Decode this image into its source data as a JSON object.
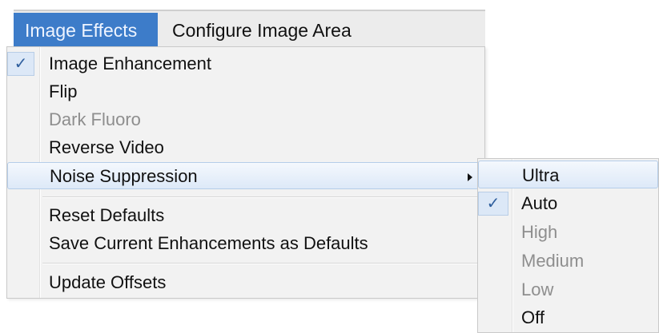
{
  "menubar": {
    "items": [
      {
        "label": "Image Effects"
      },
      {
        "label": "Configure Image Area"
      }
    ]
  },
  "menu": {
    "items": [
      {
        "label": "Image Enhancement",
        "checked": true
      },
      {
        "label": "Flip"
      },
      {
        "label": "Dark Fluoro",
        "disabled": true
      },
      {
        "label": "Reverse Video"
      },
      {
        "label": "Noise Suppression",
        "has_submenu": true,
        "highlighted": true
      },
      {
        "label": "Reset Defaults"
      },
      {
        "label": "Save Current Enhancements as Defaults"
      },
      {
        "label": "Update Offsets"
      }
    ],
    "check_glyph": "✓"
  },
  "submenu": {
    "items": [
      {
        "label": "Ultra",
        "highlighted": true
      },
      {
        "label": "Auto",
        "checked": true
      },
      {
        "label": "High",
        "disabled": true
      },
      {
        "label": "Medium",
        "disabled": true
      },
      {
        "label": "Low",
        "disabled": true
      },
      {
        "label": "Off"
      }
    ]
  },
  "colors": {
    "active_menubar": "#3d7cc9",
    "highlight_border": "#b5cde9",
    "disabled_text": "#8e8e8e"
  }
}
